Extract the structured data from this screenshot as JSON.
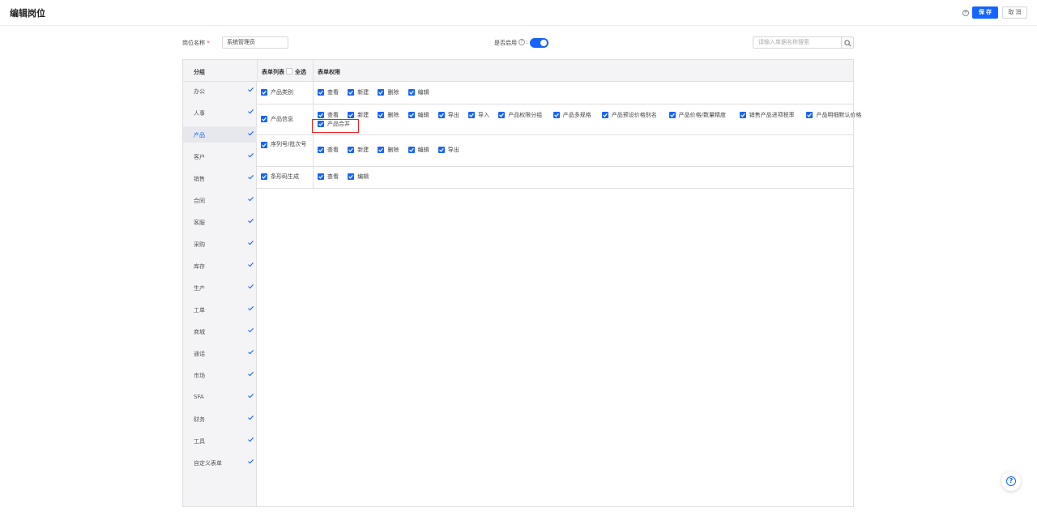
{
  "header": {
    "title": "编辑岗位",
    "save_label": "保 存",
    "cancel_label": "取 消"
  },
  "form": {
    "name_label": "岗位名称",
    "required_mark": "*",
    "name_value": "系统管理员",
    "enable_label": "是否启用",
    "enable_colon": ":",
    "enabled": true,
    "search_placeholder": "请输入单据名称搜索"
  },
  "table": {
    "col_group": "分组",
    "col_forms": "表单列表",
    "select_all": "全选",
    "col_perms": "表单权限"
  },
  "groups": [
    "办公",
    "人事",
    "产品",
    "客户",
    "销售",
    "合同",
    "客服",
    "采购",
    "库存",
    "生产",
    "工单",
    "商城",
    "通话",
    "市场",
    "SFA",
    "财务",
    "工具",
    "自定义表单"
  ],
  "active_group": "产品",
  "rows": [
    {
      "name": "产品类别",
      "perms": [
        "查看",
        "新建",
        "删除",
        "编辑"
      ]
    },
    {
      "name": "产品信息",
      "perms": [
        "查看",
        "新建",
        "删除",
        "编辑",
        "导出",
        "导入",
        "产品权限分组",
        "产品多规格",
        "产品预设价格别名",
        "产品价格/数量精度",
        "销售产品进项税率",
        "产品明细默认价格"
      ],
      "perms_line2": [
        "产品合并"
      ]
    },
    {
      "name": "序列号/批次号",
      "perms": [
        "查看",
        "新建",
        "删除",
        "编辑",
        "导出"
      ]
    },
    {
      "name": "条形码生成",
      "perms": [
        "查看",
        "编辑"
      ]
    }
  ],
  "icons": {
    "header_icon": "plus-circle-icon",
    "search": "search-icon",
    "help": "question-circle-icon"
  }
}
